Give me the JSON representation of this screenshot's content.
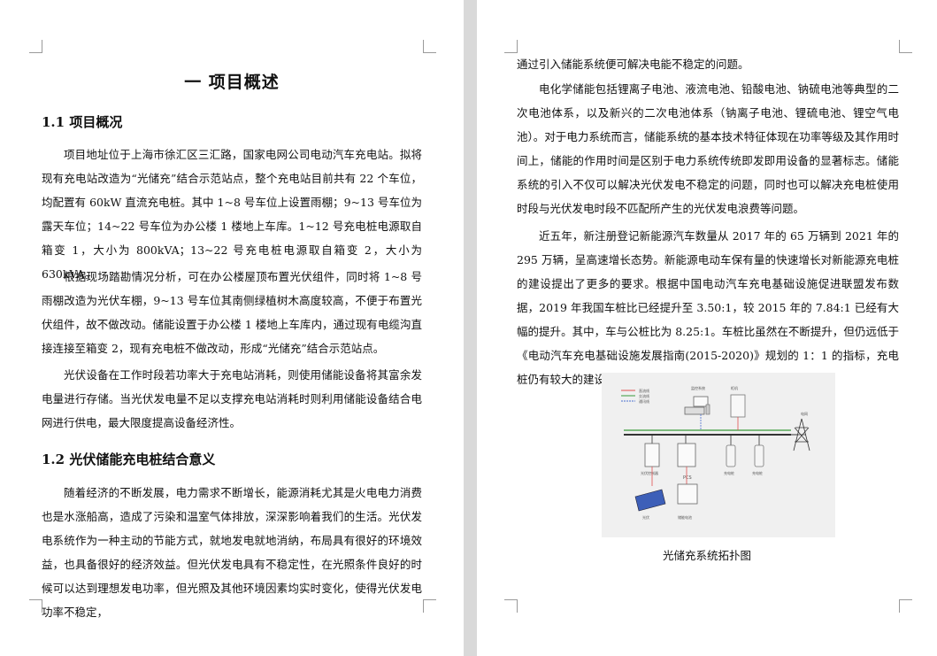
{
  "left_page": {
    "chapter_title": "一  项目概述",
    "section_1_title": "1.1 项目概况",
    "section_1_paragraphs": [
      "项目地址位于上海市徐汇区三汇路，国家电网公司电动汽车充电站。拟将现有充电站改造为“光储充”结合示范站点，整个充电站目前共有 22 个车位，均配置有 60kW 直流充电桩。其中 1~8 号车位上设置雨棚；9~13 号车位为露天车位；14~22 号车位为办公楼 1 楼地上车库。1~12 号充电桩电源取自箱变 1，大小为 800kVA；13~22 号充电桩电源取自箱变 2，大小为 630kVA。",
      "根据现场踏勘情况分析，可在办公楼屋顶布置光伏组件，同时将 1~8 号雨棚改造为光伏车棚，9~13 号车位其南侧绿植树木高度较高，不便于布置光伏组件，故不做改动。储能设置于办公楼 1 楼地上车库内，通过现有电缆沟直接连接至箱变 2，现有充电桩不做改动，形成“光储充”结合示范站点。",
      "光伏设备在工作时段若功率大于充电站消耗，则使用储能设备将其富余发电量进行存储。当光伏发电量不足以支撑充电站消耗时则利用储能设备结合电网进行供电，最大限度提高设备经济性。"
    ],
    "section_2_title": "1.2 光伏储能充电桩结合意义",
    "section_2_paragraphs": [
      "随着经济的不断发展，电力需求不断增长，能源消耗尤其是火电电力消费也是水涨船高，造成了污染和温室气体排放，深深影响着我们的生活。光伏发电系统作为一种主动的节能方式，就地发电就地消纳，布局具有很好的环境效益，也具备很好的经济效益。但光伏发电具有不稳定性，在光照条件良好的时候可以达到理想发电功率，但光照及其他环境因素均实时变化，使得光伏发电功率不稳定，"
    ]
  },
  "right_page": {
    "paragraphs": [
      "通过引入储能系统便可解决电能不稳定的问题。",
      "电化学储能包括锂离子电池、液流电池、铅酸电池、钠硫电池等典型的二次电池体系，以及新兴的二次电池体系（钠离子电池、锂硫电池、锂空气电池）。对于电力系统而言，储能系统的基本技术特征体现在功率等级及其作用时间上，储能的作用时间是区别于电力系统传统即发即用设备的显著标志。储能系统的引入不仅可以解决光伏发电不稳定的问题，同时也可以解决充电桩使用时段与光伏发电时段不匹配所产生的光伏发电浪费等问题。",
      "近五年，新注册登记新能源汽车数量从 2017 年的 65 万辆到 2021 年的 295 万辆，呈高速增长态势。新能源电动车保有量的快速增长对新能源充电桩的建设提出了更多的要求。根据中国电动汽车充电基础设施促进联盟发布数据，2019 年我国车桩比已经提升至 3.50:1，较 2015 年的 7.84:1 已经有大幅的提升。其中，车与公桩比为 8.25:1。车桩比虽然在不断提升，但仍远低于《电动汽车充电基础设施发展指南(2015-2020)》规划的 1：1 的指标，充电桩仍有较大的建设空间。"
    ],
    "figure": {
      "legend": [
        "直流线",
        "交流线",
        "通讯线"
      ],
      "labels": {
        "monitor": "监控系统",
        "cabinet": "柜机",
        "grid": "电网",
        "pv_inverter": "光伏控制器",
        "pcs": "PCS",
        "charger1": "充电桩",
        "charger2": "充电桩",
        "pv": "光伏",
        "battery": "储能电池"
      },
      "colors": {
        "dc": "#e05050",
        "ac": "#3a9a3a",
        "comm": "#4a6fd0",
        "bus": "#333333"
      },
      "caption": "光储充系统拓扑图"
    }
  }
}
